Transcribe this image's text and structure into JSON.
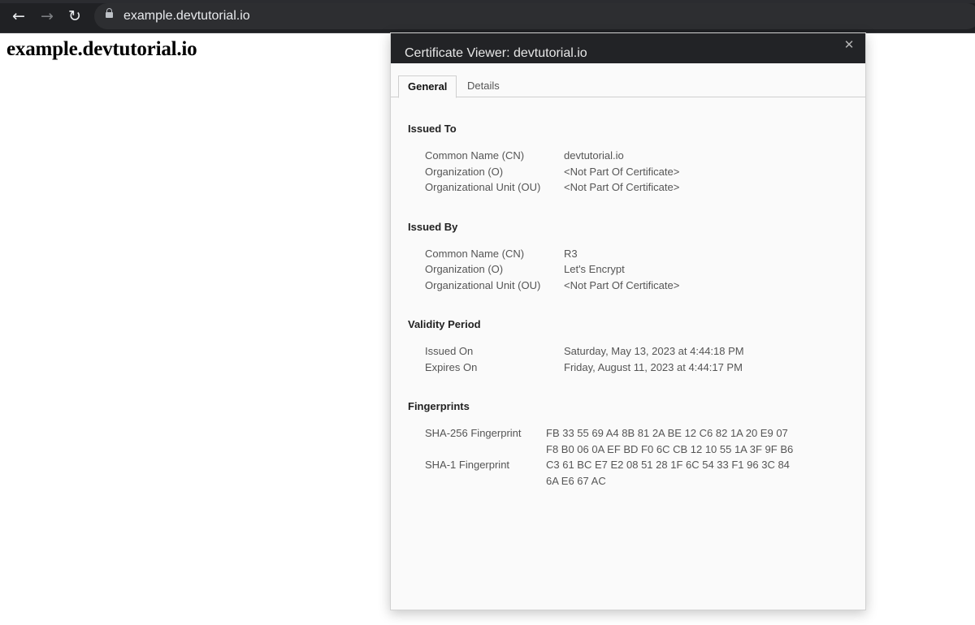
{
  "browser": {
    "back_icon": "arrow-left-icon",
    "forward_icon": "arrow-right-icon",
    "reload_icon": "reload-icon",
    "lock_icon": "lock-icon",
    "url": "example.devtutorial.io"
  },
  "page": {
    "heading": "example.devtutorial.io"
  },
  "dialog": {
    "title": "Certificate Viewer: devtutorial.io",
    "close_icon": "close-icon",
    "tabs": [
      {
        "label": "General",
        "active": true
      },
      {
        "label": "Details",
        "active": false
      }
    ],
    "sections": {
      "issued_to": {
        "title": "Issued To",
        "rows": [
          {
            "label": "Common Name (CN)",
            "value": "devtutorial.io"
          },
          {
            "label": "Organization (O)",
            "value": "<Not Part Of Certificate>"
          },
          {
            "label": "Organizational Unit (OU)",
            "value": "<Not Part Of Certificate>"
          }
        ]
      },
      "issued_by": {
        "title": "Issued By",
        "rows": [
          {
            "label": "Common Name (CN)",
            "value": "R3"
          },
          {
            "label": "Organization (O)",
            "value": "Let's Encrypt"
          },
          {
            "label": "Organizational Unit (OU)",
            "value": "<Not Part Of Certificate>"
          }
        ]
      },
      "validity": {
        "title": "Validity Period",
        "rows": [
          {
            "label": "Issued On",
            "value": "Saturday, May 13, 2023 at 4:44:18 PM"
          },
          {
            "label": "Expires On",
            "value": "Friday, August 11, 2023 at 4:44:17 PM"
          }
        ]
      },
      "fingerprints": {
        "title": "Fingerprints",
        "rows": [
          {
            "label": "SHA-256 Fingerprint",
            "value": "FB 33 55 69 A4 8B 81 2A BE 12 C6 82 1A 20 E9 07\nF8 B0 06 0A EF BD F0 6C CB 12 10 55 1A 3F 9F B6"
          },
          {
            "label": "SHA-1 Fingerprint",
            "value": "C3 61 BC E7 E2 08 51 28 1F 6C 54 33 F1 96 3C 84\n6A E6 67 AC"
          }
        ]
      }
    }
  }
}
